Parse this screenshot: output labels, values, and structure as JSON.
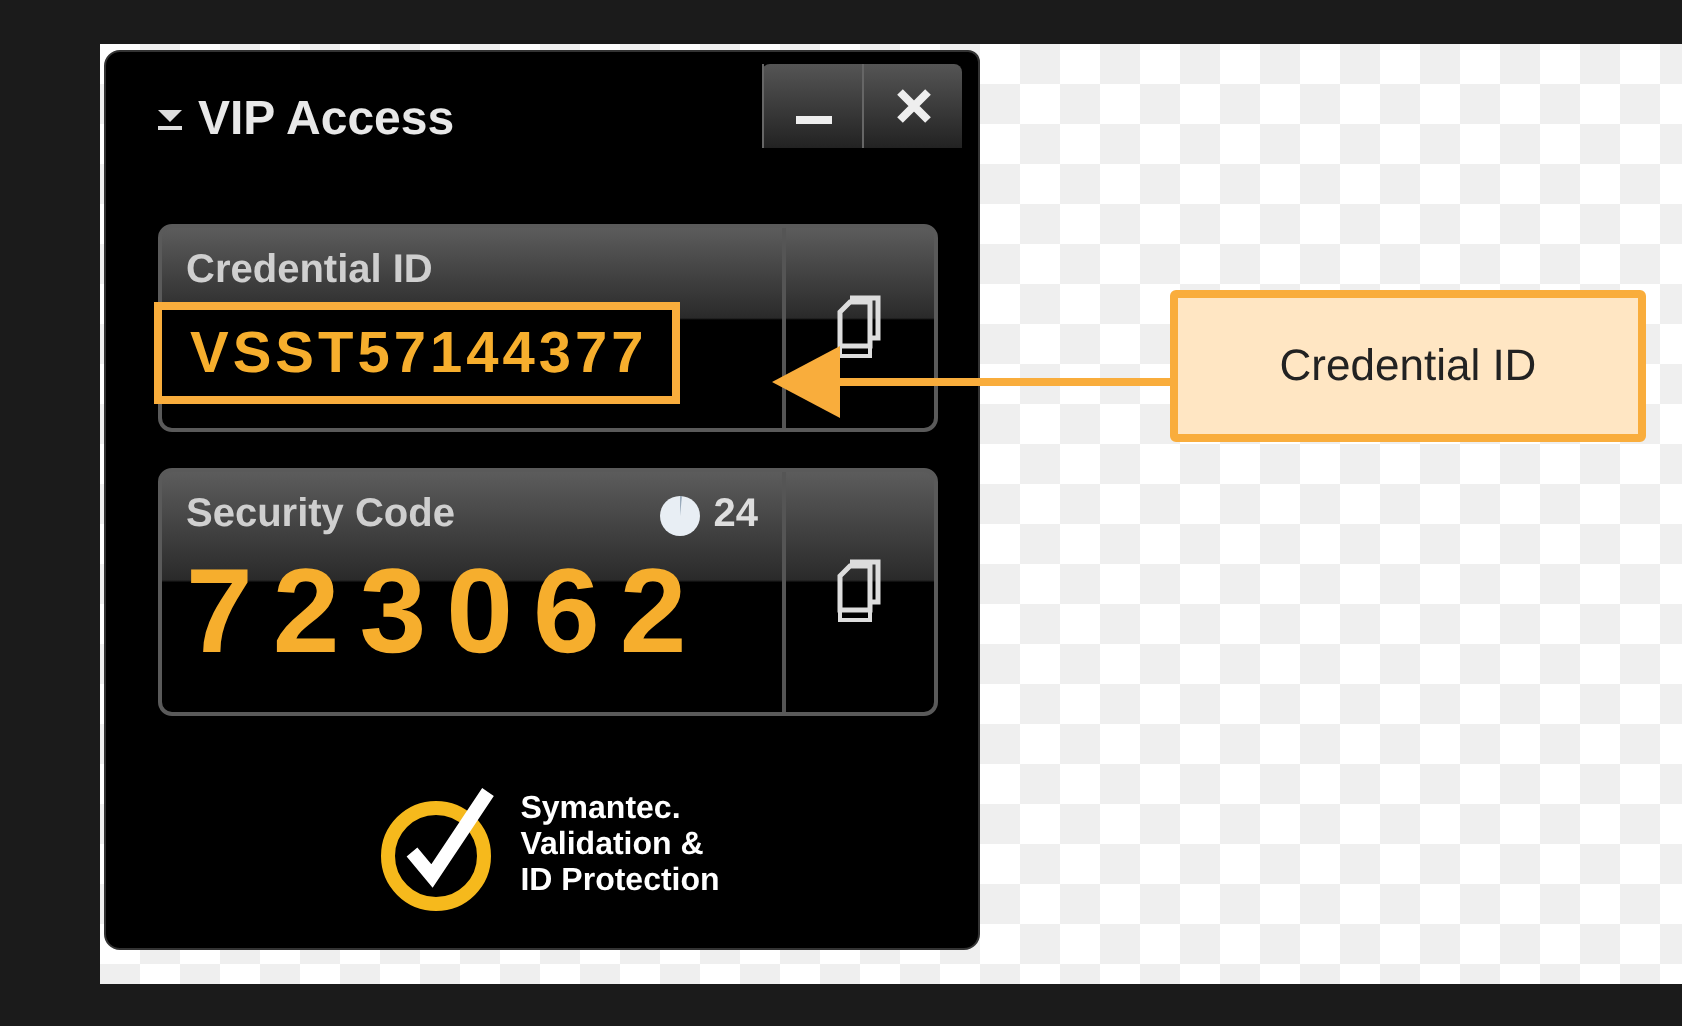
{
  "window": {
    "title": "VIP Access",
    "buttons": [
      {
        "kind": "minimize"
      },
      {
        "kind": "close"
      }
    ]
  },
  "credential": {
    "label": "Credential ID",
    "value": "VSST57144377",
    "highlighted": true
  },
  "security": {
    "label": "Security Code",
    "countdown": "24",
    "code": "723062"
  },
  "logo": {
    "lines": [
      "Symantec.",
      "Validation &",
      "ID Protection"
    ]
  },
  "callout": {
    "label": "Credential ID"
  }
}
